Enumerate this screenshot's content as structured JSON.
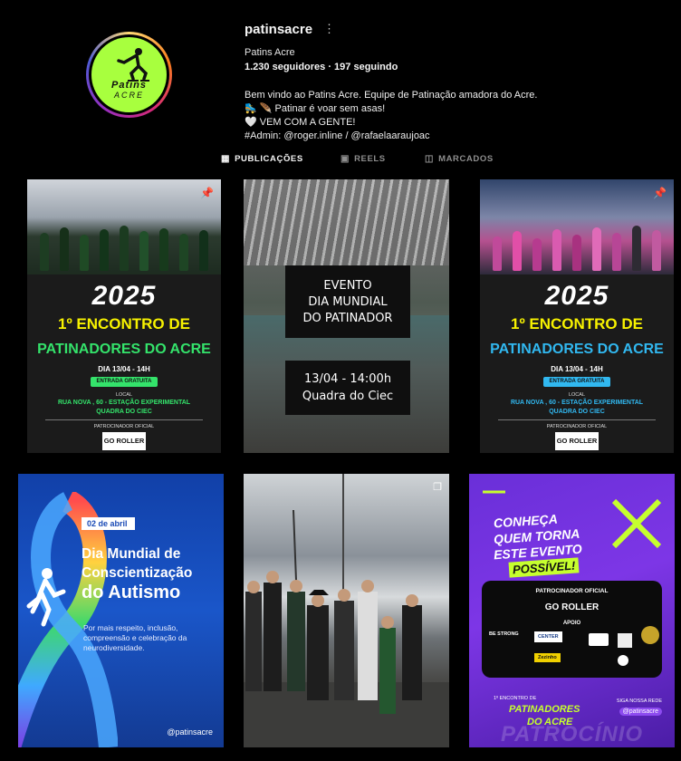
{
  "profile": {
    "username": "patinsacre",
    "more_icon": "more-icon",
    "fullname": "Patins Acre",
    "stats": "1.230 seguidores · 197 seguindo",
    "avatar_name": "Patins",
    "avatar_sub": "ACRE",
    "bio": [
      "Bem vindo ao Patins Acre. Equipe de Patinação amadora do Acre.",
      "🛼 🪶 Patinar é voar sem asas!",
      "🤍 VEM COM A GENTE!",
      "#Admin: @roger.inline / @rafaelaaraujoac"
    ]
  },
  "tabs": [
    {
      "label": "PUBLICAÇÕES",
      "icon": "grid-icon",
      "active": true
    },
    {
      "label": "REELS",
      "icon": "reels-icon",
      "active": false
    },
    {
      "label": "MARCADOS",
      "icon": "tagged-icon",
      "active": false
    }
  ],
  "posts": {
    "p1": {
      "year": "2025",
      "head1": "1º ENCONTRO DE",
      "head2": "PATINADORES DO ACRE",
      "date": "DIA 13/04 - 14H",
      "free": "ENTRADA GRATUITA",
      "local": "LOCAL",
      "addr1": "RUA NOVA , 60 - ESTAÇÃO EXPERIMENTAL",
      "addr2": "QUADRA DO CIEC",
      "sponsor_label": "PATROCINADOR OFICIAL",
      "sponsor": "GO ROLLER",
      "accent": "#34e36b"
    },
    "p2": {
      "line1": "EVENTO",
      "line2": "DIA MUNDIAL",
      "line3": "DO PATINADOR",
      "time": "13/04 - 14:00h",
      "place": "Quadra do Ciec"
    },
    "p3": {
      "year": "2025",
      "head1": "1º ENCONTRO DE",
      "head2": "PATINADORES DO ACRE",
      "date": "DIA 13/04 - 14H",
      "free": "ENTRADA GRATUITA",
      "local": "LOCAL",
      "addr1": "RUA NOVA , 60 - ESTAÇÃO EXPERIMENTAL",
      "addr2": "QUADRA DO CIEC",
      "sponsor_label": "PATROCINADOR OFICIAL",
      "sponsor": "GO ROLLER",
      "accent": "#31b8f0"
    },
    "p4": {
      "date": "02 de abril",
      "h1": "Dia Mundial de",
      "h2": "Conscientização",
      "h3": "do Autismo",
      "body": "Por mais respeito, inclusão, compreensão e celebração da neurodiversidade.",
      "handle": "@patinsacre"
    },
    "p6": {
      "h1": "CONHEÇA",
      "h2": "QUEM TORNA",
      "h3": "ESTE EVENTO",
      "h4": "POSSÍVEL!",
      "sponsor_label": "PATROCINADOR OFICIAL",
      "sponsor": "GO ROLLER",
      "apoio": "APOIO",
      "logos": [
        "BE STRONG",
        "CENTER",
        "Zezinho"
      ],
      "enc1": "1º ENCONTRO DE",
      "enc2": "PATINADORES",
      "enc3": "DO ACRE",
      "follow": "SIGA NOSSA REDE",
      "handle": "@patinsacre",
      "bottom": "PATROCÍNIO"
    }
  }
}
